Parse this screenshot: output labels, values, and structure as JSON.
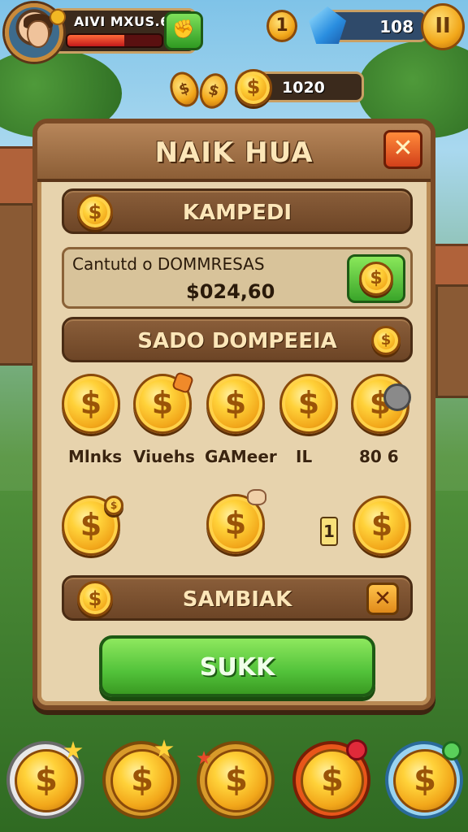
{
  "hud": {
    "player_name": "AIVI MXUS.6",
    "health_fraction": 0.6,
    "level": "1",
    "gems": "108",
    "coins": "1020",
    "pause_label": "II",
    "icons": [
      "avatar",
      "fist-icon",
      "gem-icon",
      "pause-icon",
      "coin-icon"
    ]
  },
  "dialog": {
    "title": "NAIK HUA",
    "close_label": "✕",
    "section1": "KAMPEDI",
    "info_line1": "Cantutd o DOMMRESAS",
    "info_line2": "$024,60",
    "section2": "SADO DOMPEEIA",
    "grid_row1_labels": [
      "Mlnks",
      "Viuehs",
      "GAMeer",
      "IL",
      "80 6"
    ],
    "mid_tag": "1",
    "section3": "SAMBIAK",
    "section3_close": "✕",
    "confirm_label": "SUKK"
  },
  "coin_symbol": "$",
  "colors": {
    "panel": "#e7d3ad",
    "header": "#8c5e36",
    "accent_green": "#52c23a",
    "accent_orange": "#d2401a",
    "coin_gold": "#f2a71a"
  }
}
